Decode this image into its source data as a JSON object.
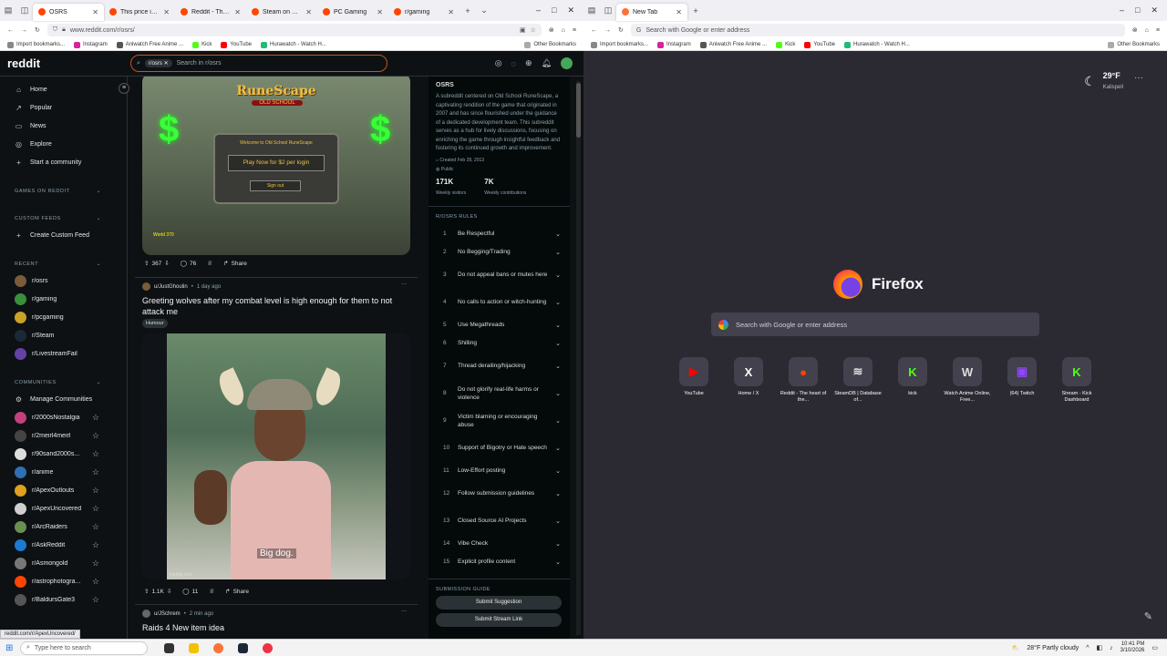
{
  "left_window": {
    "tabs": [
      {
        "label": "OSRS",
        "active": true
      },
      {
        "label": "This price increase"
      },
      {
        "label": "Reddit - The heart"
      },
      {
        "label": "Steam on Reddit"
      },
      {
        "label": "PC Gaming"
      },
      {
        "label": "r/gaming"
      }
    ],
    "url": "www.reddit.com/r/osrs/",
    "status_url": "reddit.com/r/ApexUncovered/"
  },
  "bookmarks": {
    "items": [
      "Import bookmarks...",
      "Instagram",
      "Aniwatch Free Anime ...",
      "Kick",
      "YouTube",
      "Hurawatch - Watch H..."
    ],
    "other": "Other Bookmarks"
  },
  "reddit": {
    "logo": "reddit",
    "search_chip": "r/osrs",
    "search_placeholder": "Search in r/osrs",
    "nav": [
      "Home",
      "Popular",
      "News",
      "Explore",
      "Start a community"
    ],
    "sections": {
      "games": "GAMES ON REDDIT",
      "custom": "CUSTOM FEEDS",
      "custom_create": "Create Custom Feed",
      "recent": "RECENT",
      "communities": "COMMUNITIES",
      "manage": "Manage Communities"
    },
    "recent": [
      {
        "name": "r/osrs",
        "color": "#7a5c3a"
      },
      {
        "name": "r/gaming",
        "color": "#3a8f3a"
      },
      {
        "name": "r/pcgaming",
        "color": "#c9a227"
      },
      {
        "name": "r/Steam",
        "color": "#1b2838"
      },
      {
        "name": "r/LivestreamFail",
        "color": "#6441a5"
      }
    ],
    "communities": [
      {
        "name": "r/2000sNostalgia",
        "color": "#c2407d"
      },
      {
        "name": "r/2meirl4meirl",
        "color": "#444"
      },
      {
        "name": "r/90sand2000s...",
        "color": "#ddd"
      },
      {
        "name": "r/anime",
        "color": "#2f6fb3"
      },
      {
        "name": "r/ApexOutlouts",
        "color": "#e0a020"
      },
      {
        "name": "r/ApexUncovered",
        "color": "#cfcfcf"
      },
      {
        "name": "r/ArcRaiders",
        "color": "#6a8f4f"
      },
      {
        "name": "r/AskReddit",
        "color": "#1d7ad0"
      },
      {
        "name": "r/Asmongold",
        "color": "#777"
      },
      {
        "name": "r/astrophotogra...",
        "color": "#ff4500"
      },
      {
        "name": "r/BaldursGate3",
        "color": "#555"
      }
    ],
    "post1": {
      "votes": "367",
      "comments": "76",
      "share": "Share",
      "image_text": {
        "logo": "RuneScape",
        "sub": "OLD SCHOOL",
        "welcome": "Welcome to Old School RuneScape",
        "play": "Play Now for $2 per login",
        "signin": "Sign out",
        "world": "World 370"
      }
    },
    "post2": {
      "user": "u/JustGhoulin",
      "time": "1 day ago",
      "title": "Greeting wolves after my combat level is high enough for them to not attack me",
      "flair": "Humour",
      "caption": "Big dog.",
      "watermark": "imgflip.com",
      "votes": "1.1K",
      "comments": "11",
      "share": "Share"
    },
    "post3": {
      "user": "u/JSchrem",
      "time": "2 min ago",
      "title": "Raids 4 New item idea"
    },
    "about": {
      "title": "OSRS",
      "desc": "A subreddit centered on Old School RuneScape, a captivating rendition of the game that originated in 2007 and has since flourished under the guidance of a dedicated development team. This subreddit serves as a hub for lively discussions, focusing on enriching the game through insightful feedback and fostering its continued growth and improvement.",
      "created": "Created Feb 28, 2013",
      "public": "Public",
      "visitors": "171K",
      "visitors_label": "Weekly visitors",
      "contrib": "7K",
      "contrib_label": "Weekly contributions"
    },
    "rules_head": "R/OSRS RULES",
    "rules": [
      "Be Respectful",
      "No Begging/Trading",
      "Do not appeal bans or mutes here",
      "No calls to action or witch-hunting",
      "Use Megathreads",
      "Shilling",
      "Thread derailing/hijacking",
      "Do not glorify real-life harms or violence",
      "Victim blaming or encouraging abuse",
      "Support of Bigotry or Hate speech",
      "Low-Effort posting",
      "Follow submission guidelines",
      "Closed Source AI Projects",
      "Vibe Check",
      "Explicit profile content"
    ],
    "guide_head": "SUBMISSION GUIDE",
    "guide_buttons": [
      "Submit Suggestion",
      "Submit Stream Link"
    ]
  },
  "right_window": {
    "tab": "New Tab",
    "url_placeholder": "Search with Google or enter address",
    "weather": {
      "temp": "29°F",
      "city": "Kalispell"
    },
    "brand": "Firefox",
    "search_placeholder": "Search with Google or enter address",
    "tiles": [
      {
        "label": "YouTube",
        "glyph": "▶",
        "color": "#ff0000"
      },
      {
        "label": "Home / X",
        "glyph": "X",
        "color": "#ffffff"
      },
      {
        "label": "Reddit - The heart of the...",
        "glyph": "●",
        "color": "#ff4500"
      },
      {
        "label": "SteamDB | Database of...",
        "glyph": "≋",
        "color": "#dddddd"
      },
      {
        "label": "kick",
        "glyph": "K",
        "color": "#53fc18"
      },
      {
        "label": "Watch Anime Online, Free...",
        "glyph": "W",
        "color": "#dddddd"
      },
      {
        "label": "(64) Twitch",
        "glyph": "▣",
        "color": "#9146ff"
      },
      {
        "label": "Stream - Kick Dashboard",
        "glyph": "K",
        "color": "#53fc18"
      }
    ]
  },
  "taskbar": {
    "search": "Type here to search",
    "weather": "28°F  Partly cloudy",
    "time": "10:41 PM",
    "date": "3/10/2026"
  }
}
